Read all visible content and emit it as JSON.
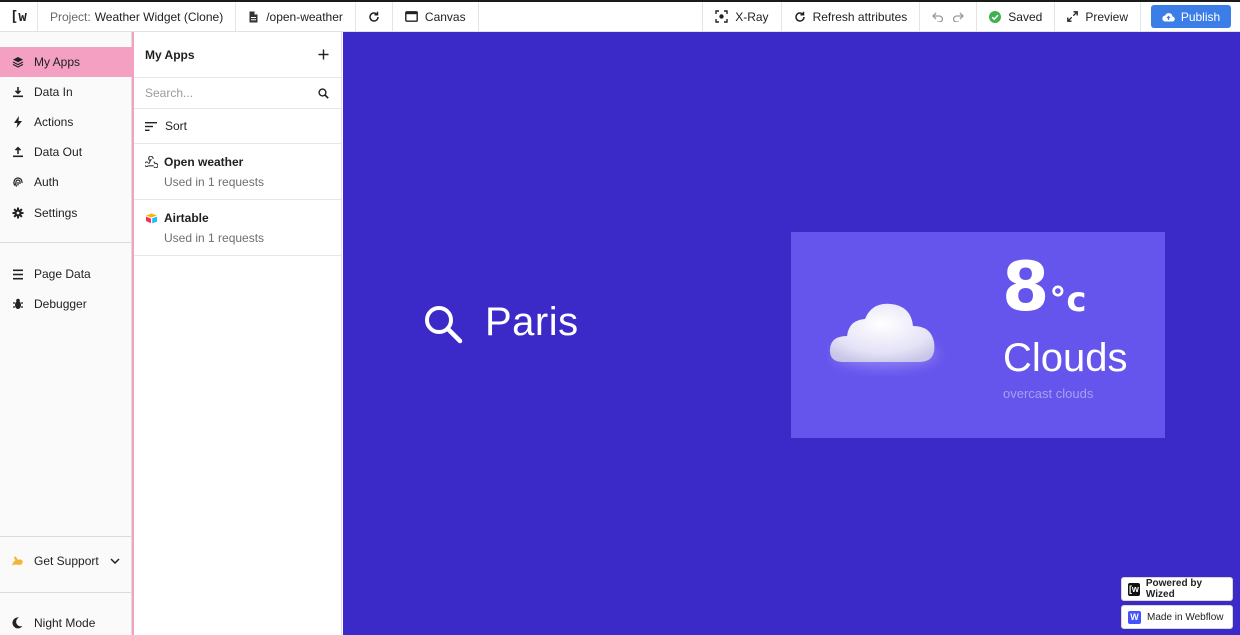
{
  "topbar": {
    "logo": "[w",
    "project_label": "Project:",
    "project_name": "Weather Widget (Clone)",
    "page_path": "/open-weather",
    "canvas_label": "Canvas",
    "xray_label": "X-Ray",
    "refresh_label": "Refresh attributes",
    "saved_label": "Saved",
    "preview_label": "Preview",
    "publish_label": "Publish"
  },
  "leftnav": {
    "items": [
      {
        "label": "My Apps",
        "icon": "layers-icon"
      },
      {
        "label": "Data In",
        "icon": "download-icon"
      },
      {
        "label": "Actions",
        "icon": "bolt-icon"
      },
      {
        "label": "Data Out",
        "icon": "upload-icon"
      },
      {
        "label": "Auth",
        "icon": "fingerprint-icon"
      },
      {
        "label": "Settings",
        "icon": "gear-icon"
      }
    ],
    "tools": [
      {
        "label": "Page Data",
        "icon": "list-icon"
      },
      {
        "label": "Debugger",
        "icon": "bug-icon"
      }
    ],
    "support_label": "Get Support",
    "night_label": "Night Mode"
  },
  "apps_panel": {
    "title": "My Apps",
    "search_placeholder": "Search...",
    "sort_label": "Sort",
    "apps": [
      {
        "name": "Open weather",
        "usage": "Used in 1 requests"
      },
      {
        "name": "Airtable",
        "usage": "Used in 1 requests"
      }
    ]
  },
  "canvas": {
    "city": "Paris",
    "temperature": "8",
    "unit": "°c",
    "condition": "Clouds",
    "description": "overcast clouds",
    "badge_wized": "Powered by Wized",
    "badge_webflow": "Made in Webflow",
    "colors": {
      "background": "#3c2ac8",
      "card": "#6655ec",
      "accent_pink": "#f4a0c2",
      "publish_blue": "#3b7ee8"
    }
  }
}
